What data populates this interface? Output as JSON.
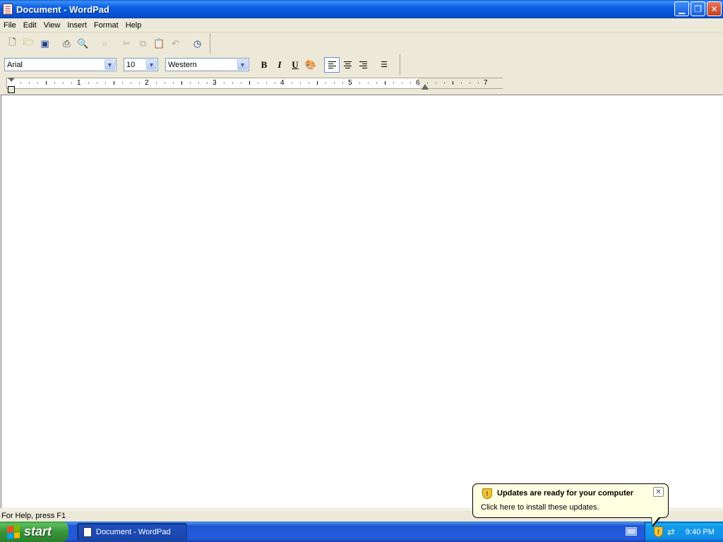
{
  "window": {
    "title": "Document - WordPad",
    "buttons": [
      "minimize",
      "restore",
      "close"
    ]
  },
  "menu": [
    "File",
    "Edit",
    "View",
    "Insert",
    "Format",
    "Help"
  ],
  "toolbar": {
    "icons": [
      "new-icon",
      "open-icon",
      "save-icon",
      "print-icon",
      "print-preview-icon",
      "find-icon",
      "cut-icon",
      "copy-icon",
      "paste-icon",
      "undo-icon",
      "date-time-icon"
    ]
  },
  "format_bar": {
    "font": "Arial",
    "size": "10",
    "script": "Western",
    "bold": "B",
    "italic": "I",
    "underline": "U"
  },
  "ruler": {
    "numbers": [
      "1",
      "2",
      "3",
      "4",
      "5",
      "6",
      "7"
    ]
  },
  "status": {
    "text": "For Help, press F1"
  },
  "taskbar": {
    "start_label": "start",
    "task_label": "Document - WordPad",
    "clock": "9:40 PM"
  },
  "balloon": {
    "title": "Updates are ready for your computer",
    "text": "Click here to install these updates."
  }
}
